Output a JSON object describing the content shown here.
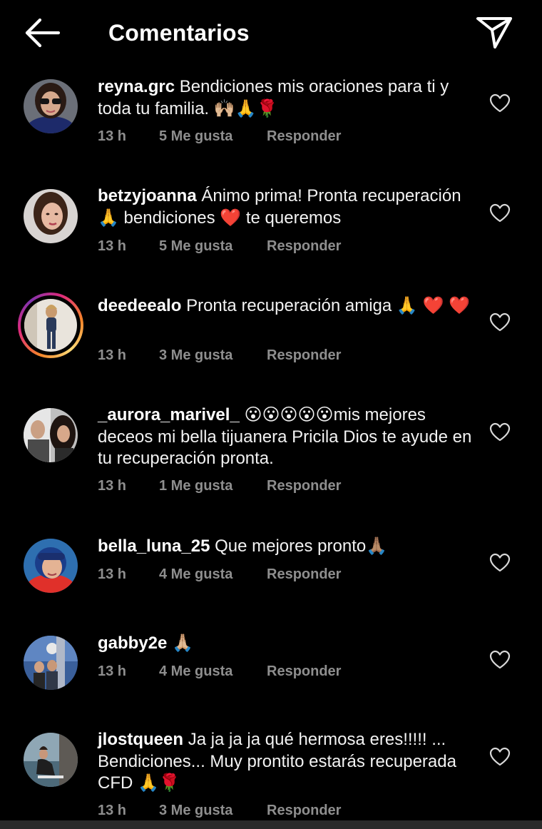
{
  "header": {
    "title": "Comentarios"
  },
  "comments": [
    {
      "username": "reyna.grc",
      "text": "Bendiciones mis oraciones para ti y toda tu familia. 🙌🏼🙏🌹",
      "time": "13 h",
      "likes": "5 Me gusta",
      "reply": "Responder"
    },
    {
      "username": "betzyjoanna",
      "text": "Ánimo prima! Pronta recuperación 🙏 bendiciones ❤️ te queremos",
      "time": "13 h",
      "likes": "5 Me gusta",
      "reply": "Responder"
    },
    {
      "username": "deedeealo",
      "text": "Pronta recuperación amiga 🙏 ❤️ ❤️",
      "time": "13 h",
      "likes": "3 Me gusta",
      "reply": "Responder"
    },
    {
      "username": "_aurora_marivel_",
      "text": "😮😮😮😮😮mis mejores deceos mi bella tijuanera Pricila Dios te ayude en tu recuperación pronta.",
      "time": "13 h",
      "likes": "1 Me gusta",
      "reply": "Responder"
    },
    {
      "username": "bella_luna_25",
      "text": "Que mejores pronto🙏🏽",
      "time": "13 h",
      "likes": "4 Me gusta",
      "reply": "Responder"
    },
    {
      "username": "gabby2e",
      "text": "🙏🏼",
      "time": "13 h",
      "likes": "4 Me gusta",
      "reply": "Responder"
    },
    {
      "username": "jlostqueen",
      "text": "Ja ja ja ja qué hermosa eres!!!!! ... Bendiciones... Muy prontito estarás recuperada CFD 🙏🌹",
      "time": "13 h",
      "likes": "3 Me gusta",
      "reply": "Responder"
    }
  ]
}
